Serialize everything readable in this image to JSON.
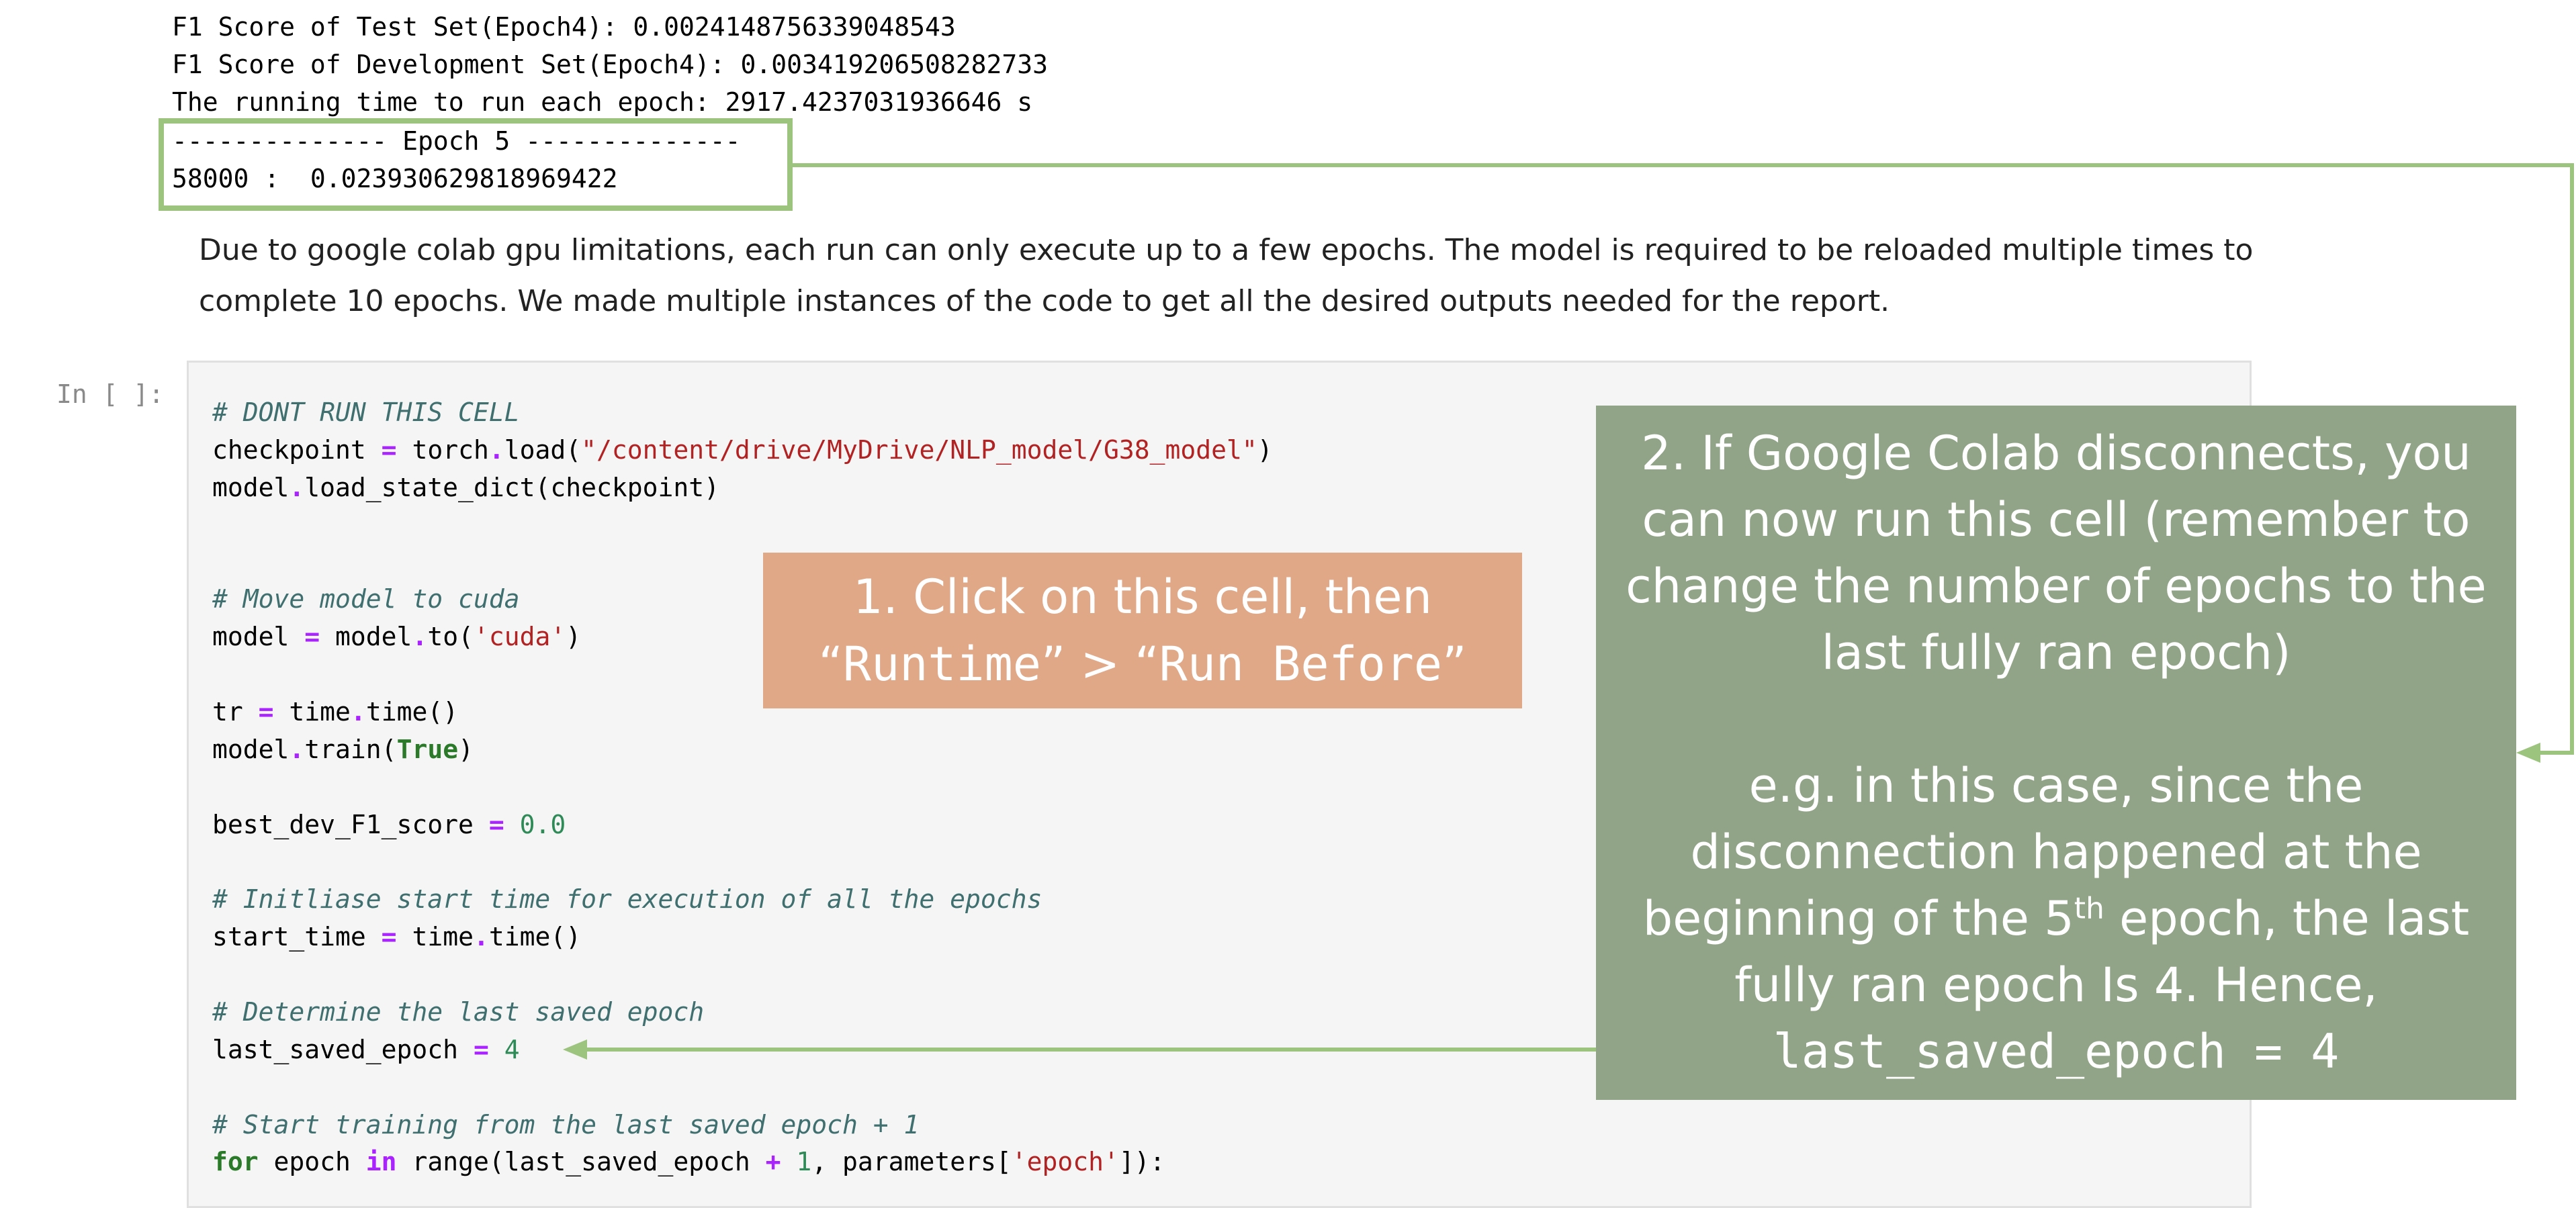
{
  "output": {
    "lines": [
      "F1 Score of Test Set(Epoch4): 0.0024148756339048543",
      "F1 Score of Development Set(Epoch4): 0.003419206508282733",
      "The running time to run each epoch: 2917.4237031936646 s",
      "-------------- Epoch 5 --------------",
      "58000 :  0.023930629818969422"
    ]
  },
  "note": {
    "line1": "Due to google colab gpu limitations, each run can only execute up to a few epochs. The model is required to be reloaded multiple times to",
    "line2": "complete 10 epochs. We made multiple instances of the code to get all the desired outputs needed for the report."
  },
  "cell": {
    "prompt": "In [ ]:",
    "code": {
      "c1": "# DONT RUN THIS CELL",
      "l2a": "checkpoint ",
      "l2op": "=",
      "l2b": " torch",
      "l2dot": ".",
      "l2c": "load(",
      "l2str": "\"/content/drive/MyDrive/NLP_model/G38_model\"",
      "l2d": ")",
      "l3a": "model",
      "l3dot": ".",
      "l3b": "load_state_dict(checkpoint)",
      "c4": "# Move model to cuda",
      "l5a": "model ",
      "l5op": "=",
      "l5b": " model",
      "l5dot": ".",
      "l5c": "to(",
      "l5str": "'cuda'",
      "l5d": ")",
      "l6a": "tr ",
      "l6op": "=",
      "l6b": " time",
      "l6dot": ".",
      "l6c": "time()",
      "l7a": "model",
      "l7dot": ".",
      "l7b": "train(",
      "l7kw": "True",
      "l7c": ")",
      "l8a": "best_dev_F1_score ",
      "l8op": "=",
      "l8num": " 0.0",
      "c9": "# Initliase start time for execution of all the epochs",
      "l10a": "start_time ",
      "l10op": "=",
      "l10b": " time",
      "l10dot": ".",
      "l10c": "time()",
      "c11": "# Determine the last saved epoch",
      "l12a": "last_saved_epoch ",
      "l12op": "=",
      "l12num": " 4",
      "c13": "# Start training from the last saved epoch + 1",
      "l14kw": "for",
      "l14a": " epoch ",
      "l14op": "in",
      "l14b": " range(last_saved_epoch ",
      "l14op2": "+",
      "l14num": " 1",
      "l14c": ", parameters[",
      "l14str": "'epoch'",
      "l14d": "]):"
    }
  },
  "callout1": {
    "line1": "1. Click on this cell, then",
    "q1": "“",
    "mono1": "Runtime",
    "q2": "”",
    "sep": " > ",
    "q3": "“",
    "mono2": "Run Before",
    "q4": "”"
  },
  "callout2": {
    "p1": "2. If Google Colab disconnects, you can now run this cell (remember to change the number of epochs to the last fully ran epoch)",
    "p2a": "e.g. in this case, since the disconnection happened at the beginning of the 5",
    "p2sup": "th",
    "p2b": " epoch, the last fully ran epoch Is 4. Hence,",
    "p2code": "last_saved_epoch = 4"
  },
  "colors": {
    "highlight_green": "#9cc47e",
    "callout_orange": "#e0a887",
    "callout_green": "#91a488"
  }
}
